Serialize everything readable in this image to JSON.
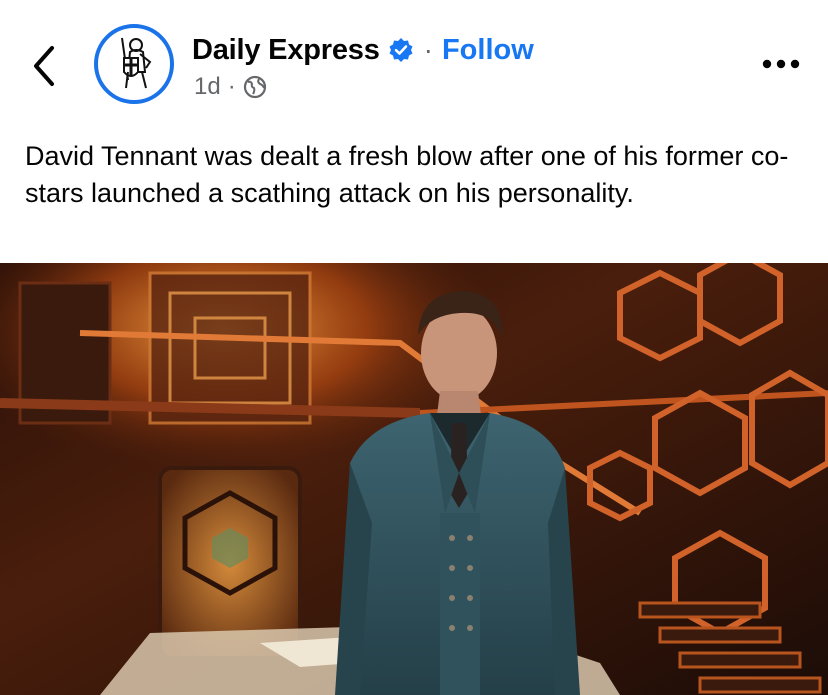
{
  "header": {
    "page_name": "Daily Express",
    "separator": "·",
    "follow_label": "Follow",
    "time": "1d",
    "meta_separator": "·",
    "icons": {
      "back": "chevron-left-icon",
      "avatar": "daily-express-crusader-logo",
      "verified": "verified-badge-icon",
      "audience": "globe-icon",
      "more": "more-options-icon"
    }
  },
  "post": {
    "caption": "David Tennant was dealt a fresh blow after one of his former co-stars launched a scathing attack on his personality."
  },
  "colors": {
    "accent": "#1877f2",
    "avatar_ring": "#1a73e8",
    "meta_text": "#65676b"
  }
}
